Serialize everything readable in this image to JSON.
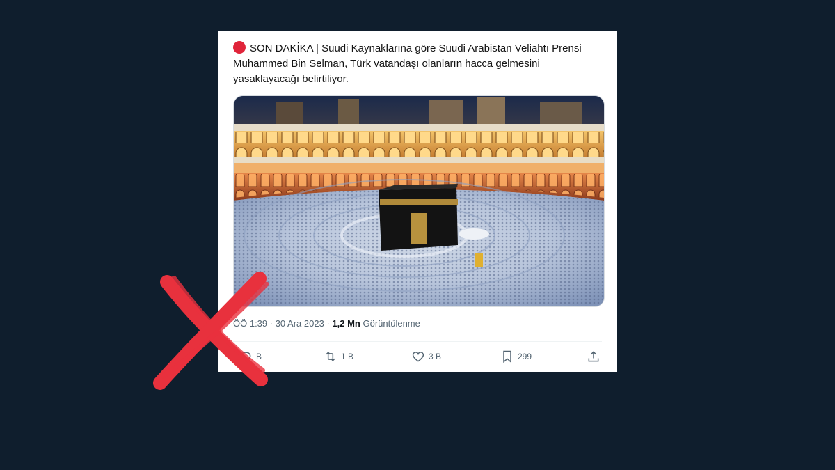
{
  "tweet": {
    "text": "SON DAKİKA | Suudi Kaynaklarına göre Suudi Arabistan Veliahtı Prensi Muhammed Bin Selman, Türk vatandaşı olanların hacca gelmesini yasaklayacağı belirtiliyor.",
    "time": "ÖÖ 1:39",
    "separator": " · ",
    "date": "30 Ara 2023",
    "views_count": "1,2 Mn",
    "views_label": "Görüntülenme"
  },
  "actions": {
    "reply_count": "B",
    "retweet_count": "1 B",
    "like_count": "3 B",
    "bookmark_count": "299"
  },
  "colors": {
    "background": "#0f1e2d",
    "breaking_dot": "#e0243a",
    "false_mark": "#e8313d",
    "muted_text": "#536471"
  },
  "icons": [
    "red-dot-icon",
    "reply-icon",
    "retweet-icon",
    "like-icon",
    "bookmark-icon",
    "share-icon",
    "false-x-icon"
  ]
}
